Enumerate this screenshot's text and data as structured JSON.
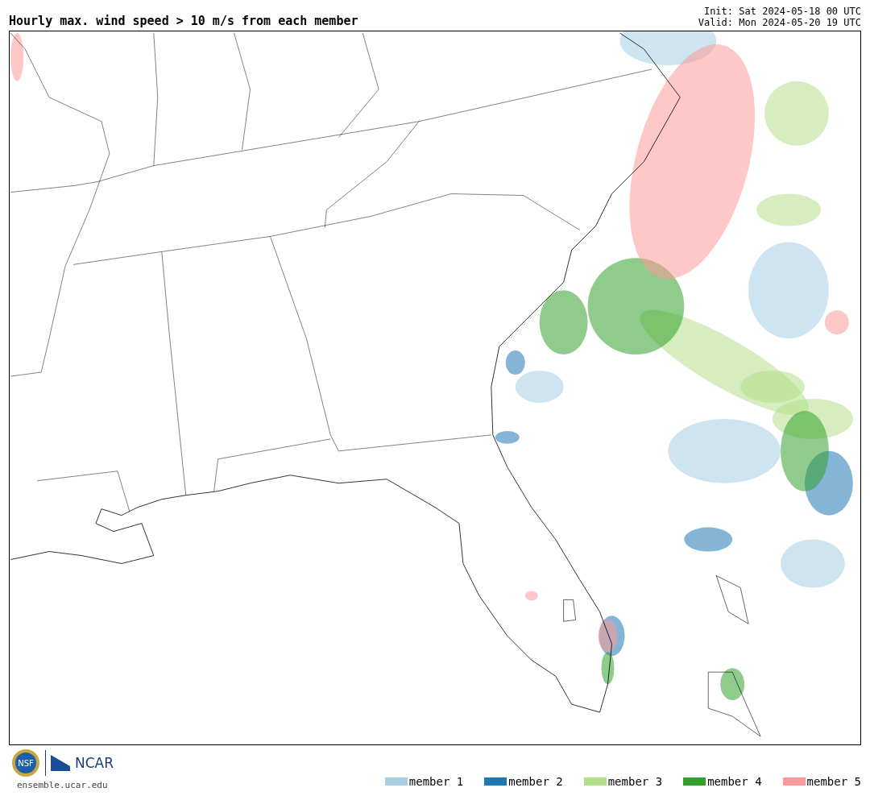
{
  "title": "Hourly max. wind speed > 10 m/s from each member",
  "init": "Init: Sat 2024-05-18 00 UTC",
  "valid": "Valid: Mon 2024-05-20 19 UTC",
  "logos": {
    "nsf": "NSF",
    "ncar": "NCAR"
  },
  "site": "ensemble.ucar.edu",
  "legend": [
    {
      "label": "member 1",
      "color": "#a6cee3"
    },
    {
      "label": "member 2",
      "color": "#1f78b4"
    },
    {
      "label": "member 3",
      "color": "#b2df8a"
    },
    {
      "label": "member 4",
      "color": "#33a02c"
    },
    {
      "label": "member 5",
      "color": "#fb9a99"
    }
  ]
}
